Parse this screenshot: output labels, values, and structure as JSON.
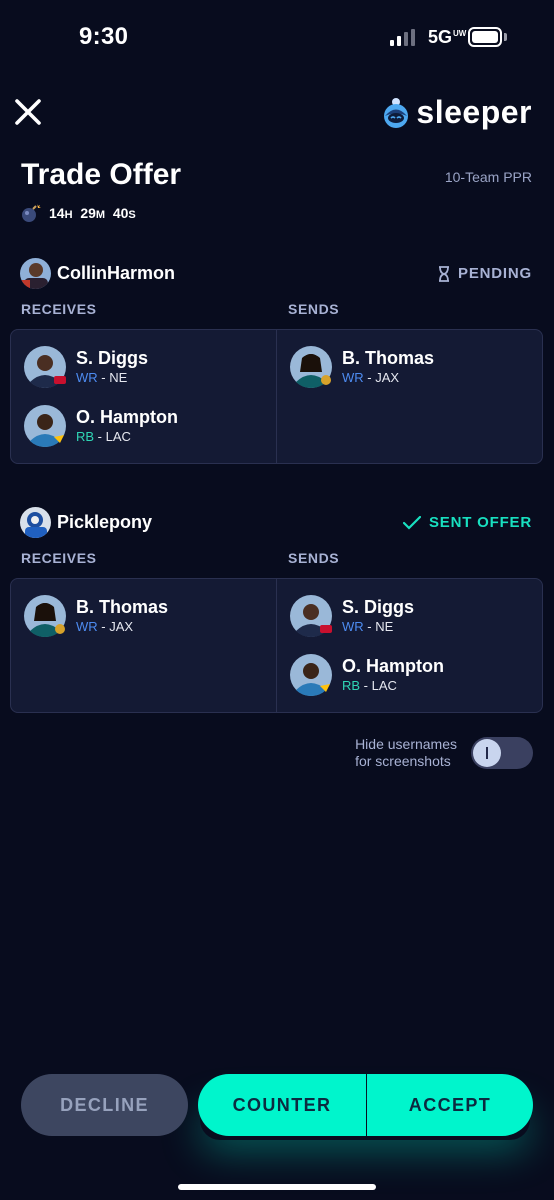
{
  "status_bar": {
    "time": "9:30",
    "network": "5G",
    "network_sub": "UW"
  },
  "header": {
    "brand": "sleeper",
    "title": "Trade Offer",
    "league": "10-Team PPR"
  },
  "timer": {
    "hours": "14",
    "h_unit": "H",
    "minutes": "29",
    "m_unit": "M",
    "seconds": "40",
    "s_unit": "S"
  },
  "trades": [
    {
      "username": "CollinHarmon",
      "status": "PENDING",
      "receives_label": "RECEIVES",
      "sends_label": "SENDS",
      "receives": [
        {
          "name": "S. Diggs",
          "pos": "WR",
          "team": "NE"
        },
        {
          "name": "O. Hampton",
          "pos": "RB",
          "team": "LAC"
        }
      ],
      "sends": [
        {
          "name": "B. Thomas",
          "pos": "WR",
          "team": "JAX"
        }
      ]
    },
    {
      "username": "Picklepony",
      "status": "SENT OFFER",
      "receives_label": "RECEIVES",
      "sends_label": "SENDS",
      "receives": [
        {
          "name": "B. Thomas",
          "pos": "WR",
          "team": "JAX"
        }
      ],
      "sends": [
        {
          "name": "S. Diggs",
          "pos": "WR",
          "team": "NE"
        },
        {
          "name": "O. Hampton",
          "pos": "RB",
          "team": "LAC"
        }
      ]
    }
  ],
  "toggle": {
    "label_line1": "Hide usernames",
    "label_line2": "for screenshots",
    "enabled": false
  },
  "actions": {
    "decline": "DECLINE",
    "counter": "COUNTER",
    "accept": "ACCEPT"
  },
  "colors": {
    "background": "#080c1e",
    "accent": "#00f5cc",
    "wr": "#4d8bf0",
    "rb": "#2fd5b5"
  }
}
